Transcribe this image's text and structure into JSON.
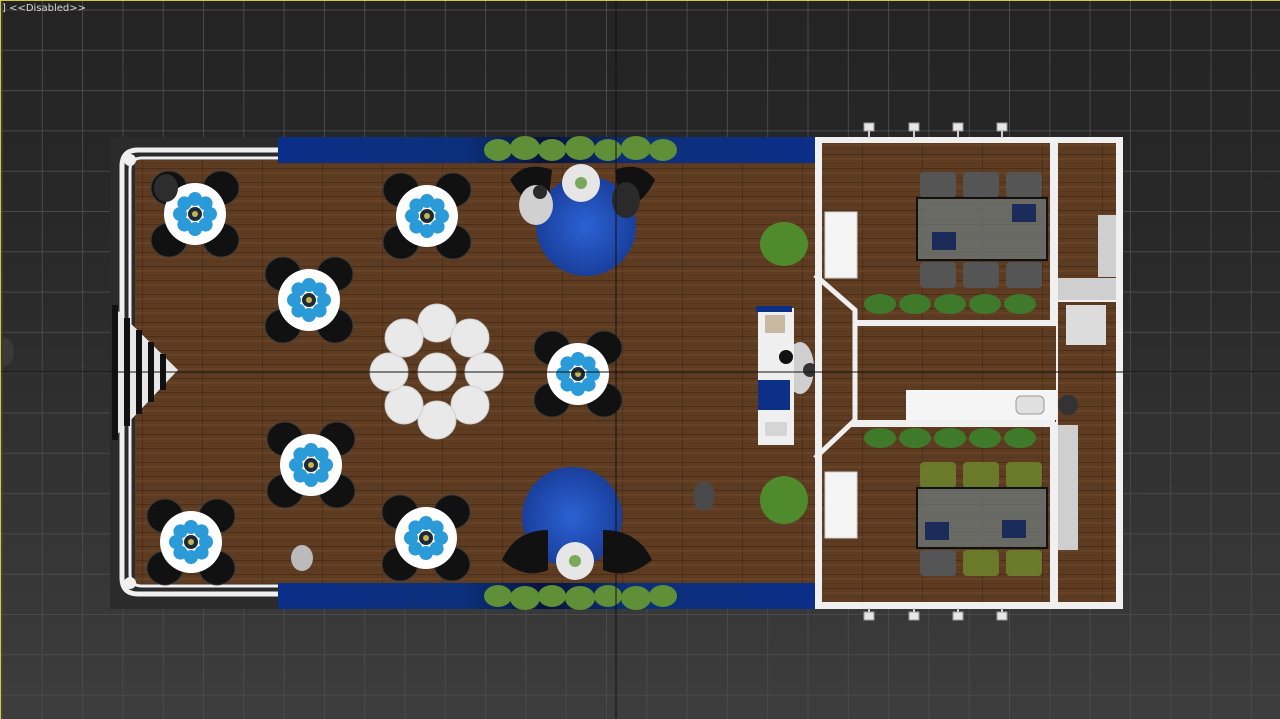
{
  "viewport": {
    "label": "] <<Disabled>>",
    "view": "top",
    "grid_visible": true,
    "background_top": "#232323",
    "background_bottom": "#3d3d3d",
    "active_border_color": "#d8c83a"
  },
  "booth": {
    "floor_color": "#5e3c22",
    "wall_color": "#f0f0f0",
    "fascia_color": "#0a2f8a",
    "plant_color": "#5f8f36",
    "rug_color": "#1f4fc0",
    "chair_color": "#111111",
    "table_accent": "#2a9ad8",
    "meeting_rooms": 2,
    "lounge_tables": 8,
    "spotlights": 8
  }
}
